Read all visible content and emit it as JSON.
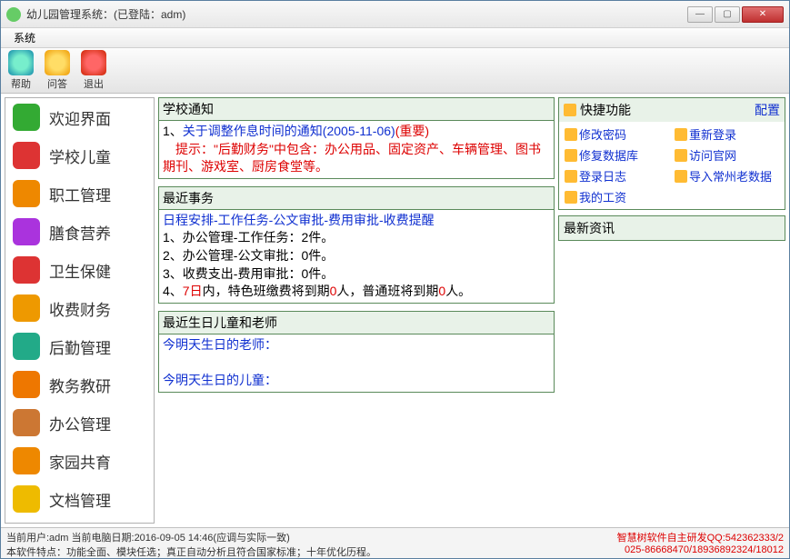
{
  "titlebar": {
    "title": "幼儿园管理系统：(已登陆：adm)"
  },
  "menubar": {
    "system": "系统"
  },
  "toolbar": {
    "help": "帮助",
    "qa": "问答",
    "exit": "退出"
  },
  "sidebar": {
    "items": [
      {
        "label": "欢迎界面",
        "color": "#3a3"
      },
      {
        "label": "学校儿童",
        "color": "#d33"
      },
      {
        "label": "职工管理",
        "color": "#e80"
      },
      {
        "label": "膳食营养",
        "color": "#a3d"
      },
      {
        "label": "卫生保健",
        "color": "#d33"
      },
      {
        "label": "收费财务",
        "color": "#e90"
      },
      {
        "label": "后勤管理",
        "color": "#2a8"
      },
      {
        "label": "教务教研",
        "color": "#e70"
      },
      {
        "label": "办公管理",
        "color": "#c73"
      },
      {
        "label": "家园共育",
        "color": "#e80"
      },
      {
        "label": "文档管理",
        "color": "#eb0"
      }
    ]
  },
  "notice": {
    "title": "学校通知",
    "line1_prefix": "1、",
    "line1_link": "关于调整作息时间的通知(2005-11-06)",
    "line1_suffix": "(重要)",
    "tip": "　提示：\"后勤财务\"中包含：办公用品、固定资产、车辆管理、图书期刊、游戏室、厨房食堂等。"
  },
  "recent": {
    "title": "最近事务",
    "head": "日程安排-工作任务-公文审批-费用审批-收费提醒",
    "l1": "1、办公管理-工作任务：2件。",
    "l2": "2、办公管理-公文审批：0件。",
    "l3": "3、收费支出-费用审批：0件。",
    "l4a": "4、",
    "l4b": "7日",
    "l4c": "内，特色班缴费将到期",
    "l4d": "0",
    "l4e": "人，普通班将到期",
    "l4f": "0",
    "l4g": "人。"
  },
  "birthday": {
    "title": "最近生日儿童和老师",
    "teacher": "今明天生日的老师：",
    "child": "今明天生日的儿童："
  },
  "quick": {
    "title": "快捷功能",
    "config": "配置",
    "links": [
      "修改密码",
      "重新登录",
      "修复数据库",
      "访问官网",
      "登录日志",
      "导入常州老数据",
      "我的工资"
    ]
  },
  "news": {
    "title": "最新资讯"
  },
  "status": {
    "left1": "当前用户:adm 当前电脑日期:2016-09-05 14:46(应调与实际一致)",
    "left2": "本软件特点：功能全面、模块任选；真正自动分析且符合国家标准；十年优化历程。",
    "right1": "智慧树软件自主研发QQ:542362333/2",
    "right2": "025-86668470/18936892324/18012"
  }
}
